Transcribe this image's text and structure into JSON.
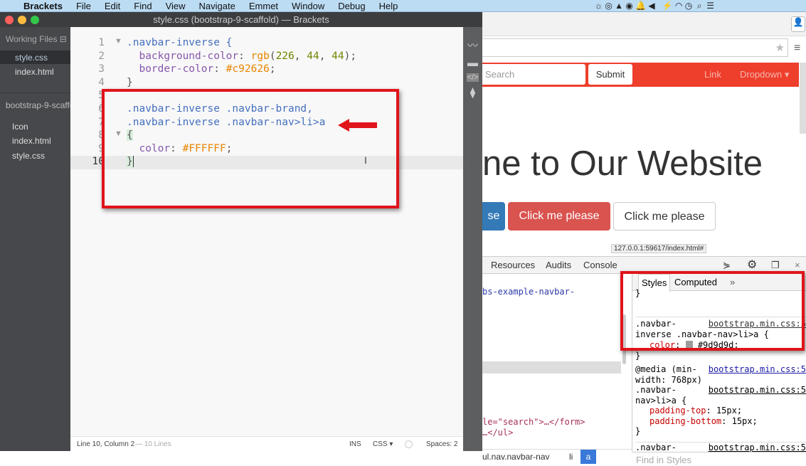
{
  "menubar": {
    "app": "Brackets",
    "items": [
      "File",
      "Edit",
      "Find",
      "View",
      "Navigate",
      "Emmet",
      "Window",
      "Debug",
      "Help"
    ]
  },
  "window": {
    "title": "style.css (bootstrap-9-scaffold) — Brackets"
  },
  "sidebar": {
    "working_files_label": "Working Files",
    "working_files": [
      "style.css",
      "index.html"
    ],
    "project": "bootstrap-9-scaffold",
    "tree": [
      "Icon",
      "index.html",
      "style.css"
    ]
  },
  "editor": {
    "lines": [
      "1",
      "2",
      "3",
      "4",
      "5",
      "6",
      "7",
      "8",
      "9",
      "10"
    ],
    "code": {
      "l1": ".navbar-inverse {",
      "l2a": "background-color",
      "l2b": "rgb",
      "l2c": "(",
      "l2d": "226",
      ", ": ", ",
      "l2e": "44",
      "l2f": "44",
      "l2g": ");",
      "l3a": "border-color",
      "l3b": "#c92626",
      "l4": "}",
      "l6": ".navbar-inverse .navbar-brand,",
      "l7": ".navbar-inverse .navbar-nav>li>a",
      "l8": "{",
      "l9a": "color",
      "l9b": "#FFFFFF",
      "l10": "}"
    }
  },
  "status": {
    "position": "Line 10, Column 2",
    "lines": "— 10 Lines",
    "mode": "INS",
    "language": "CSS",
    "spaces": "Spaces: 2"
  },
  "browser": {
    "search_placeholder": "Search",
    "submit": "Submit",
    "link": "Link",
    "dropdown": "Dropdown",
    "hero": "ne to Our Website",
    "btn1": "se",
    "btn2": "Click me please",
    "btn3": "Click me please",
    "url_tooltip": "127.0.0.1:59617/index.html#"
  },
  "devtools": {
    "tabs": [
      "Resources",
      "Audits",
      "Console"
    ],
    "elements": [
      "bs-example-navbar-",
      "le=\"search\">…</form>",
      "…</ul>"
    ],
    "breadcrumb": [
      "ul.nav.navbar-nav",
      "li",
      "a"
    ],
    "styles_tabs": [
      "Styles",
      "Computed",
      "»"
    ],
    "rule1": {
      "sel1": ".navbar-",
      "sel2": "inverse .navbar-nav>li>a {",
      "source": "bootstrap.min.css:5",
      "prop": "color",
      "value": "#9d9d9d;",
      "swatch": "#9d9d9d"
    },
    "rule2": {
      "media1": "@media (min-",
      "media2": "width: 768px)",
      "source_media": "bootstrap.min.css:5",
      "sel1": ".navbar-",
      "sel2": "nav>li>a {",
      "source": "bootstrap.min.css:5",
      "p1": "padding-top",
      "v1": "15px;",
      "p2": "padding-bottom",
      "v2": "15px;"
    },
    "rule3": {
      "sel1": ".navbar-",
      "source": "bootstrap.min.css:5"
    },
    "find_placeholder": "Find in Styles",
    "close_brace": "}"
  },
  "colors": {
    "navbar": "#ee3e2c",
    "highlight_box": "#e0141b",
    "btn_danger": "#d9534f",
    "btn_primary": "#337ab7"
  }
}
